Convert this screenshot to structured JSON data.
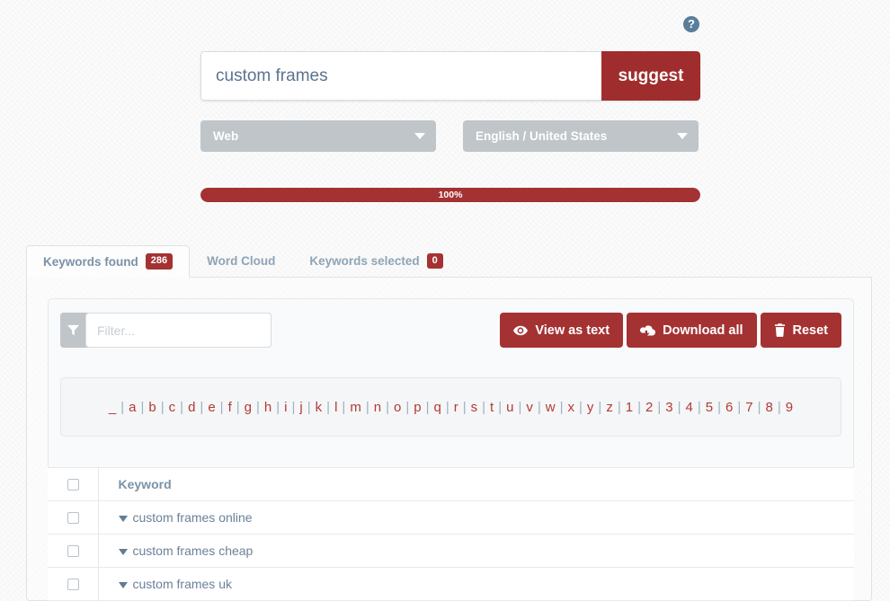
{
  "help": {
    "icon": "question-mark-circle-icon",
    "label": "?"
  },
  "search": {
    "value": "custom frames",
    "placeholder": "",
    "button_label": "suggest"
  },
  "filters": {
    "search_type": {
      "value": "Web",
      "caret": "chevron-down-icon"
    },
    "language": {
      "value": "English / United States",
      "caret": "chevron-down-icon"
    }
  },
  "progress": {
    "percent": 100,
    "label": "100%",
    "color": "#a43232"
  },
  "tabs": [
    {
      "label": "Keywords found",
      "badge": "286",
      "active": true
    },
    {
      "label": "Word Cloud",
      "badge": null,
      "active": false
    },
    {
      "label": "Keywords selected",
      "badge": "0",
      "active": false
    }
  ],
  "toolbar": {
    "filter_icon": "funnel-icon",
    "filter_placeholder": "Filter...",
    "filter_value": "",
    "buttons": [
      {
        "label": "View as text",
        "icon": "eye-icon"
      },
      {
        "label": "Download all",
        "icon": "cloud-download-icon"
      },
      {
        "label": "Reset",
        "icon": "trash-icon"
      }
    ]
  },
  "alphabet": [
    "_",
    "a",
    "b",
    "c",
    "d",
    "e",
    "f",
    "g",
    "h",
    "i",
    "j",
    "k",
    "l",
    "m",
    "n",
    "o",
    "p",
    "q",
    "r",
    "s",
    "t",
    "u",
    "v",
    "w",
    "x",
    "y",
    "z",
    "1",
    "2",
    "3",
    "4",
    "5",
    "6",
    "7",
    "8",
    "9"
  ],
  "table": {
    "header": {
      "keyword": "Keyword"
    },
    "rows": [
      {
        "keyword": "custom frames online"
      },
      {
        "keyword": "custom frames cheap"
      },
      {
        "keyword": "custom frames uk"
      }
    ]
  },
  "colors": {
    "brand_red": "#a43232",
    "accent_link_red": "#b33a33",
    "text_blue_gray": "#5f7d95",
    "control_gray": "#bfc5c9"
  }
}
